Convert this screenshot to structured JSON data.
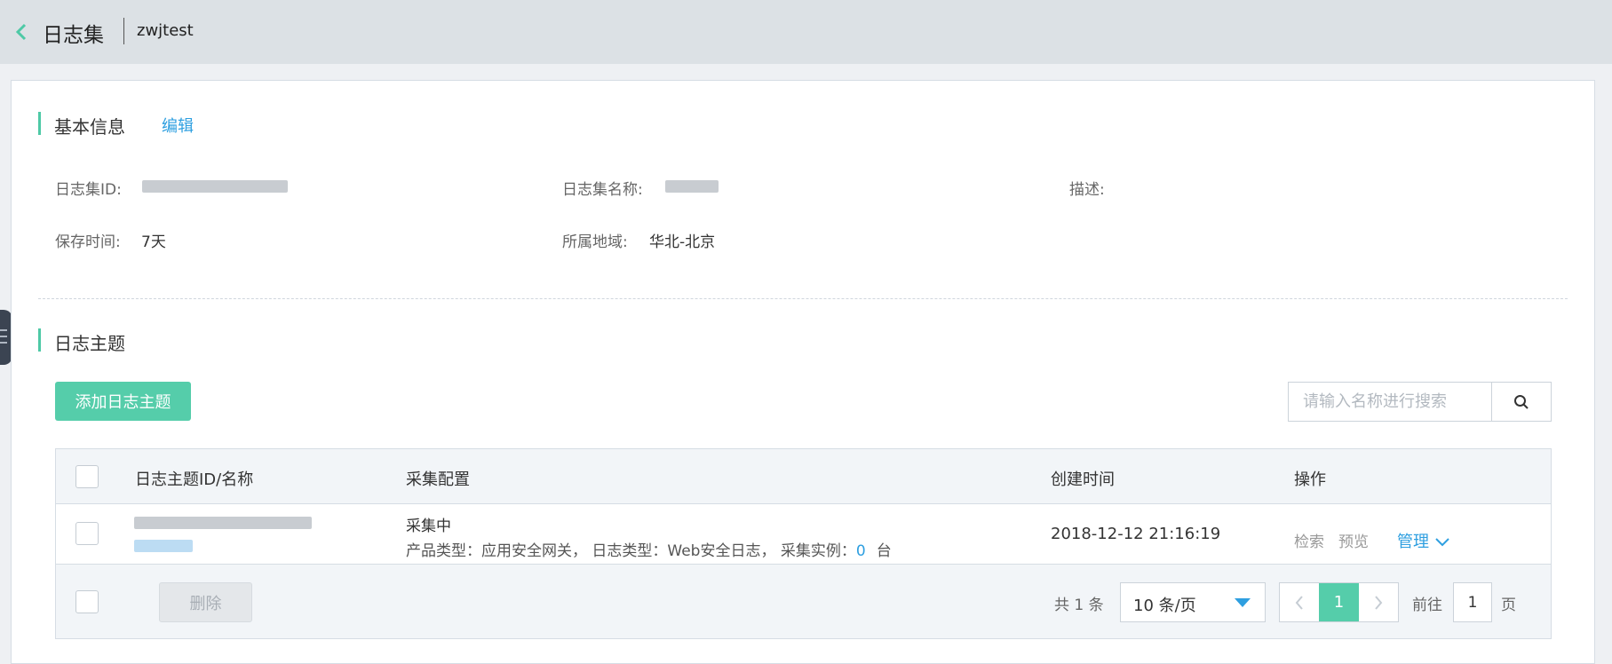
{
  "header": {
    "title": "日志集",
    "subtitle": "zwjtest"
  },
  "basic_info": {
    "section_title": "基本信息",
    "edit_label": "编辑",
    "fields": {
      "id_label": "日志集ID:",
      "name_label": "日志集名称:",
      "desc_label": "描述:",
      "retention_label": "保存时间:",
      "retention_value": "7天",
      "region_label": "所属地域:",
      "region_value": "华北-北京"
    }
  },
  "topics": {
    "section_title": "日志主题",
    "add_button": "添加日志主题",
    "search_placeholder": "请输入名称进行搜索",
    "columns": [
      "日志主题ID/名称",
      "采集配置",
      "创建时间",
      "操作"
    ],
    "rows": [
      {
        "status": "采集中",
        "config_prefix": "产品类型：应用安全网关， 日志类型：Web安全日志， 采集实例：",
        "instances": "0",
        "unit": "台",
        "created": "2018-12-12 21:16:19",
        "actions": {
          "search": "检索",
          "preview": "预览",
          "manage": "管理"
        }
      }
    ],
    "footer": {
      "delete_button": "删除",
      "total": "共 1 条",
      "page_size": "10 条/页",
      "current_page": "1",
      "goto_label": "前往",
      "goto_value": "1",
      "page_label": "页"
    }
  },
  "colors": {
    "accent_green": "#55cdaa",
    "link_blue": "#2e9fe0",
    "topbar_bg": "#dce1e5"
  },
  "icons": [
    "chevron-left-icon",
    "search-icon",
    "chevron-down-icon",
    "caret-down-icon",
    "chevron-right-icon"
  ]
}
